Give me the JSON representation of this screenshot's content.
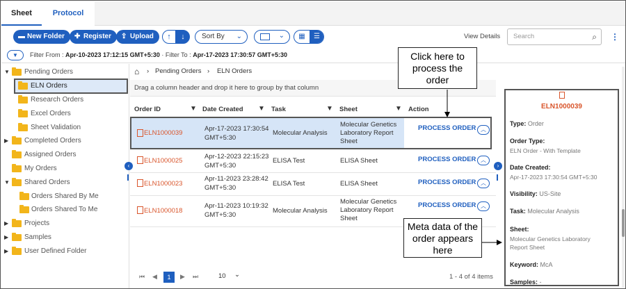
{
  "tabs": [
    {
      "label": "Sheet"
    },
    {
      "label": "Protocol"
    }
  ],
  "toolbar": {
    "new_folder": "New Folder",
    "register": "Register",
    "upload": "Upload",
    "sort_by": "Sort By",
    "view_details": "View Details",
    "search_placeholder": "Search"
  },
  "filter": {
    "from_label": "Filter From :",
    "from_value": "Apr-10-2023 17:12:15 GMT+5:30",
    "to_label": "Filter To :",
    "to_value": "Apr-17-2023 17:30:57 GMT+5:30"
  },
  "sidebar": {
    "items": [
      {
        "label": "Pending Orders"
      },
      {
        "label": "ELN Orders"
      },
      {
        "label": "Research Orders"
      },
      {
        "label": "Excel Orders"
      },
      {
        "label": "Sheet Validation"
      },
      {
        "label": "Completed Orders"
      },
      {
        "label": "Assigned Orders"
      },
      {
        "label": "My Orders"
      },
      {
        "label": "Shared Orders"
      },
      {
        "label": "Orders Shared By Me"
      },
      {
        "label": "Orders Shared To Me"
      },
      {
        "label": "Projects"
      },
      {
        "label": "Samples"
      },
      {
        "label": "User Defined Folder"
      }
    ]
  },
  "breadcrumb": {
    "level1": "Pending Orders",
    "level2": "ELN Orders"
  },
  "group_hint": "Drag a column header and drop it here to group by that column",
  "table": {
    "columns": [
      "Order ID",
      "Date Created",
      "Task",
      "Sheet",
      "Action"
    ],
    "rows": [
      {
        "id": "ELN1000039",
        "date1": "Apr-17-2023 17:30:54",
        "date2": "GMT+5:30",
        "task": "Molecular Analysis",
        "sheet1": "Molecular Genetics",
        "sheet2": "Laboratory Report",
        "sheet3": "Sheet",
        "action": "PROCESS ORDER"
      },
      {
        "id": "ELN1000025",
        "date1": "Apr-12-2023 22:15:23",
        "date2": "GMT+5:30",
        "task": "ELISA Test",
        "sheet1": "ELISA Sheet",
        "sheet2": "",
        "sheet3": "",
        "action": "PROCESS ORDER"
      },
      {
        "id": "ELN1000023",
        "date1": "Apr-11-2023 23:28:42",
        "date2": "GMT+5:30",
        "task": "ELISA Test",
        "sheet1": "ELISA Sheet",
        "sheet2": "",
        "sheet3": "",
        "action": "PROCESS ORDER"
      },
      {
        "id": "ELN1000018",
        "date1": "Apr-11-2023 10:19:32",
        "date2": "GMT+5:30",
        "task": "Molecular Analysis",
        "sheet1": "Molecular Genetics",
        "sheet2": "Laboratory Report",
        "sheet3": "Sheet",
        "action": "PROCESS ORDER"
      }
    ]
  },
  "pager": {
    "page": "1",
    "page_size": "10",
    "summary": "1 - 4 of 4 items"
  },
  "details": {
    "title": "ELN1000039",
    "type_label": "Type:",
    "type_value": "Order",
    "order_type_label": "Order Type:",
    "order_type_value": "ELN Order - With Template",
    "date_label": "Date Created:",
    "date_value": "Apr-17-2023 17:30:54 GMT+5:30",
    "visibility_label": "Visibility:",
    "visibility_value": "US-Site",
    "task_label": "Task:",
    "task_value": "Molecular Analysis",
    "sheet_label": "Sheet:",
    "sheet_value1": "Molecular Genetics Laboratory",
    "sheet_value2": "Report Sheet",
    "keyword_label": "Keyword:",
    "keyword_value": "McA",
    "samples_label": "Samples:",
    "samples_value": "-"
  },
  "callouts": {
    "top_l1": "Click here to",
    "top_l2": "process the",
    "top_l3": "order",
    "bot_l1": "Meta data of the",
    "bot_l2": "order appears",
    "bot_l3": "here"
  },
  "colors": {
    "accent": "#1f5fbf",
    "order_id": "#d9552b",
    "folder": "#f2b51b",
    "selected_row": "#d6e5f7"
  }
}
